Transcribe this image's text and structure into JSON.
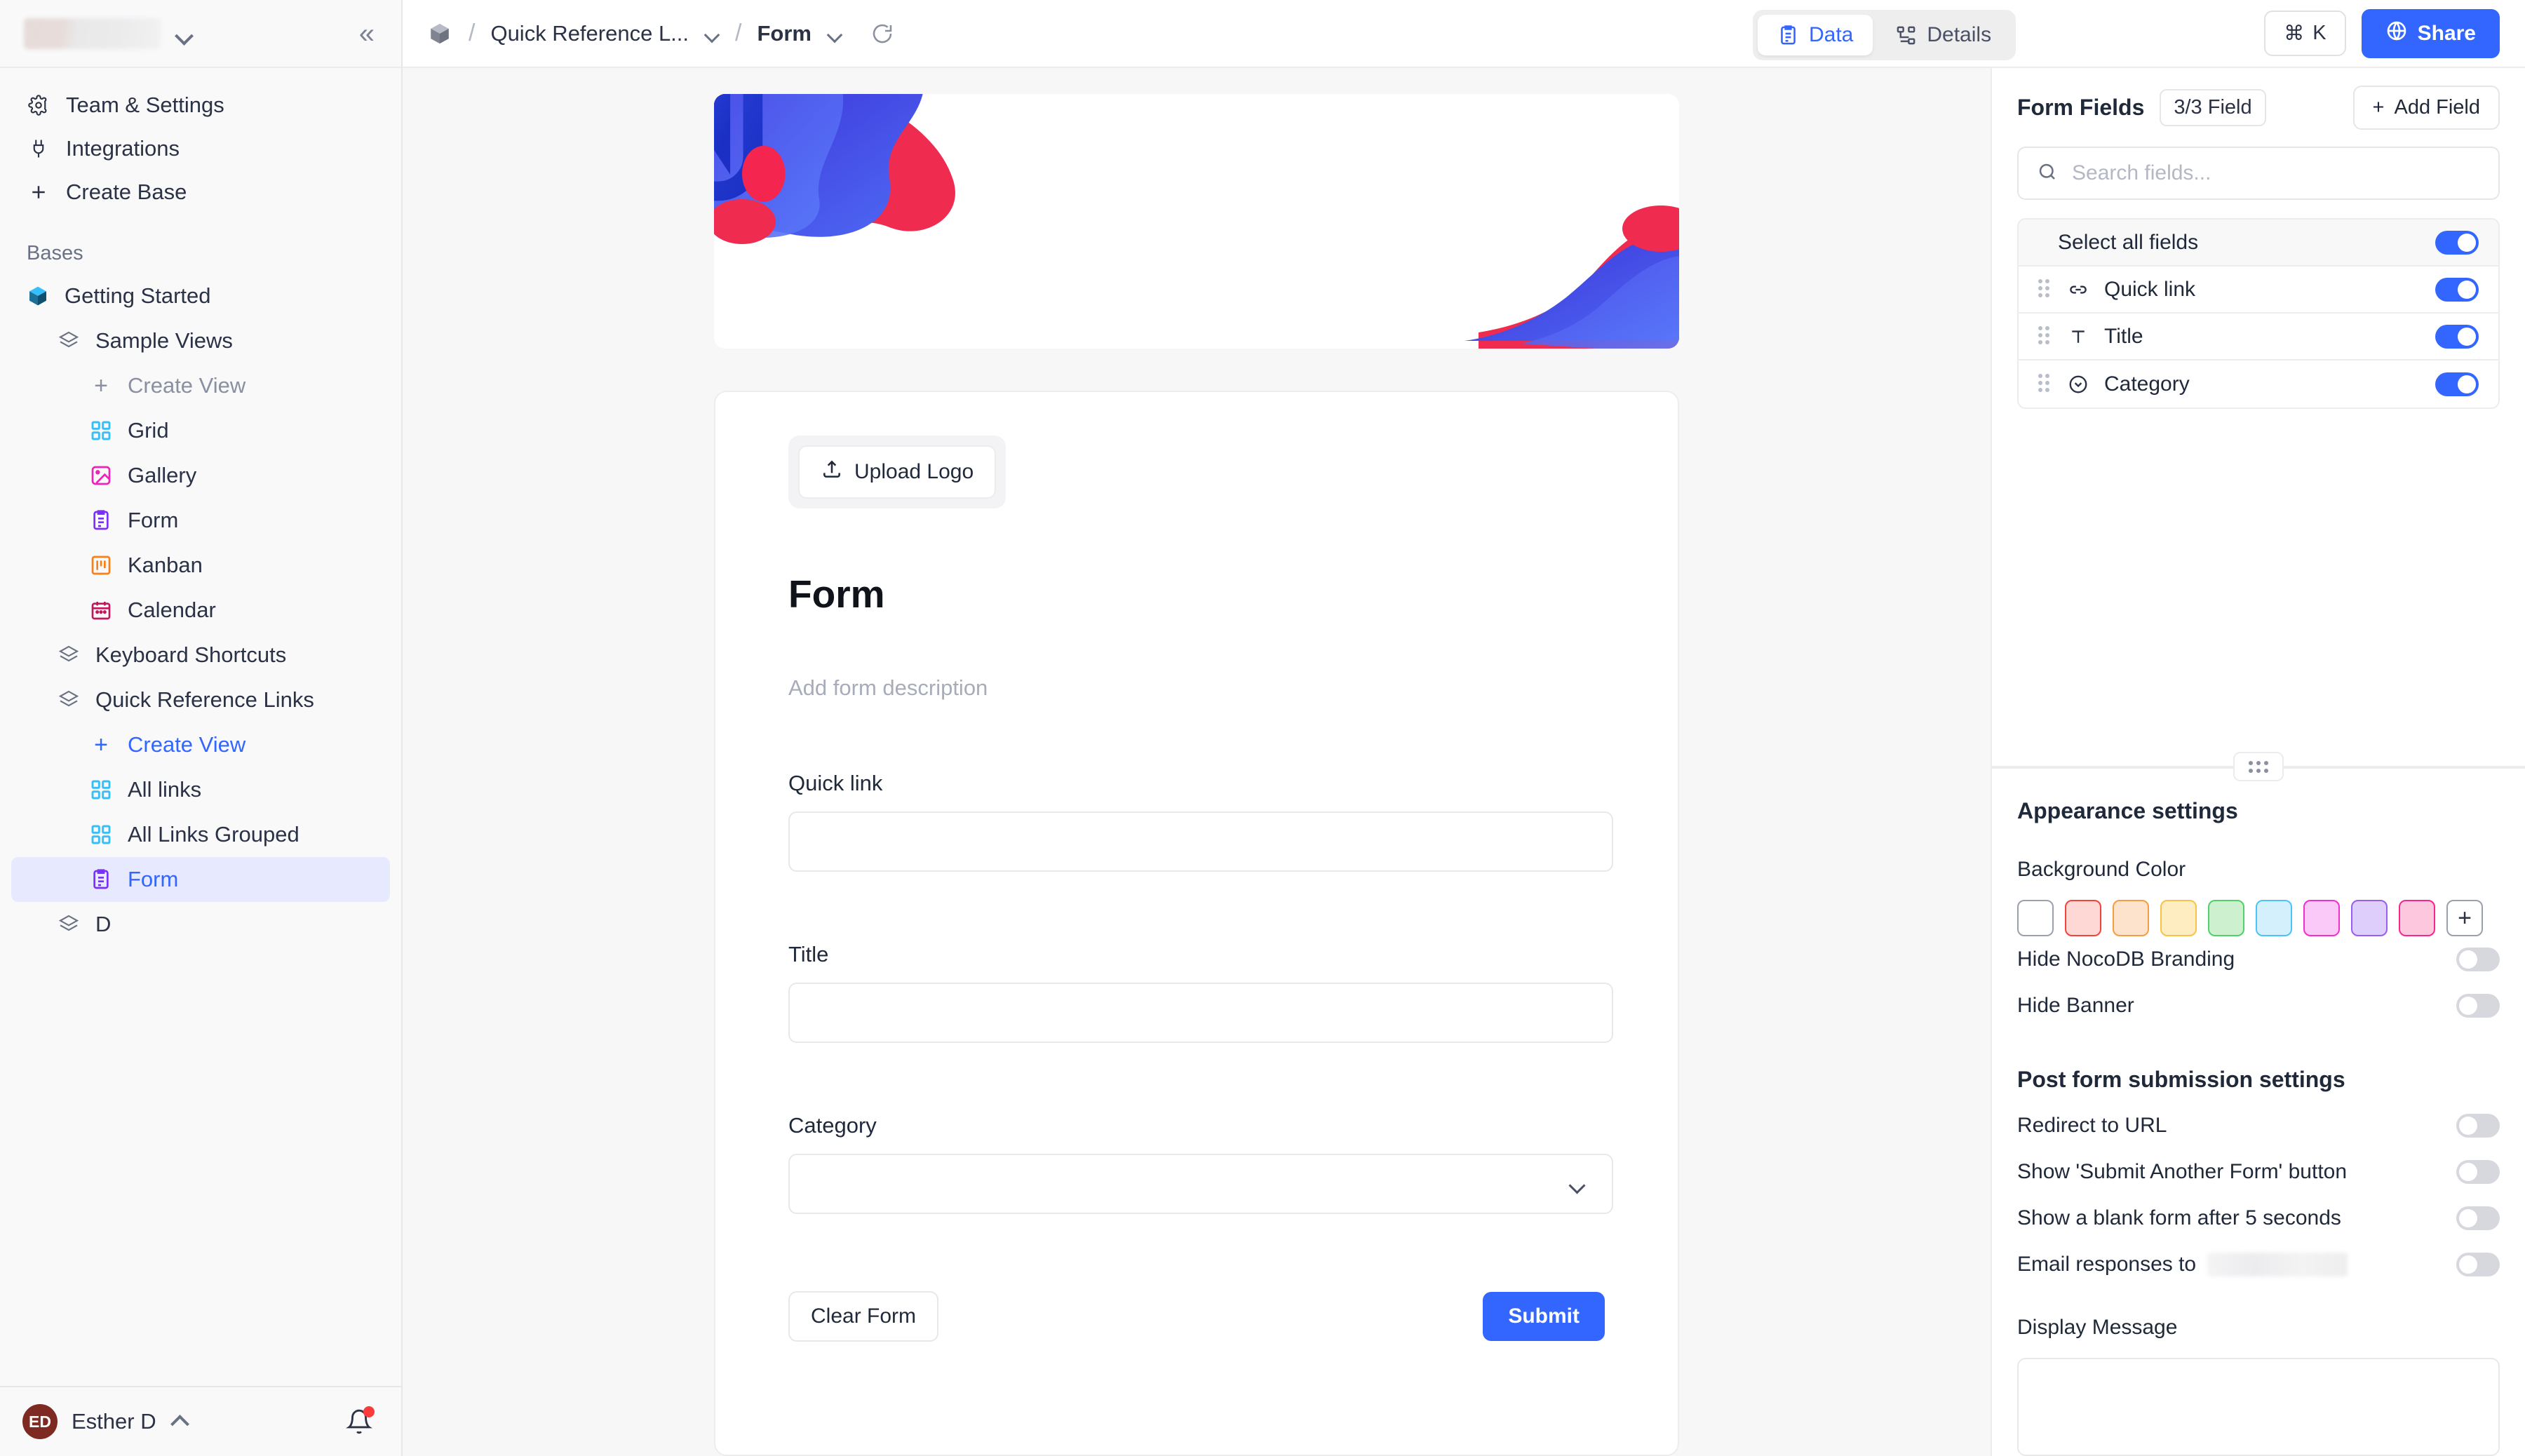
{
  "sidebar": {
    "workspace": {
      "name_redacted": true,
      "chevron_icon": "chevron-down-icon",
      "collapse_icon": "collapse-left-icon"
    },
    "nav": [
      {
        "label": "Team & Settings",
        "icon": "gear-icon"
      },
      {
        "label": "Integrations",
        "icon": "plug-icon"
      },
      {
        "label": "Create Base",
        "icon": "plus-icon"
      }
    ],
    "bases_label": "Bases",
    "tree": [
      {
        "label": "Getting Started",
        "icon": "base-icon",
        "level": 0,
        "state": "normal"
      },
      {
        "label": "Sample Views",
        "icon": "table-icon",
        "level": 1,
        "state": "normal"
      },
      {
        "label": "Create View",
        "icon": "plus-icon",
        "level": 2,
        "state": "muted"
      },
      {
        "label": "Grid",
        "icon": "grid-view-icon",
        "level": 2,
        "state": "normal"
      },
      {
        "label": "Gallery",
        "icon": "gallery-view-icon",
        "level": 2,
        "state": "normal"
      },
      {
        "label": "Form",
        "icon": "form-view-icon",
        "level": 2,
        "state": "normal"
      },
      {
        "label": "Kanban",
        "icon": "kanban-view-icon",
        "level": 2,
        "state": "normal"
      },
      {
        "label": "Calendar",
        "icon": "calendar-view-icon",
        "level": 2,
        "state": "normal"
      },
      {
        "label": "Keyboard Shortcuts",
        "icon": "table-icon",
        "level": 1,
        "state": "normal"
      },
      {
        "label": "Quick Reference Links",
        "icon": "table-icon",
        "level": 1,
        "state": "normal"
      },
      {
        "label": "Create View",
        "icon": "plus-icon",
        "level": 2,
        "state": "accent"
      },
      {
        "label": "All links",
        "icon": "grid-view-icon",
        "level": 2,
        "state": "normal"
      },
      {
        "label": "All Links Grouped",
        "icon": "grid-view-icon",
        "level": 2,
        "state": "normal"
      },
      {
        "label": "Form",
        "icon": "form-view-icon",
        "level": 2,
        "state": "selected"
      },
      {
        "label": "D",
        "icon": "table-icon",
        "level": 1,
        "state": "normal"
      }
    ],
    "user": {
      "initials": "ED",
      "name": "Esther D",
      "chevron_icon": "chevron-up-icon",
      "bell_icon": "bell-icon",
      "has_notification": true
    }
  },
  "topbar": {
    "breadcrumb": {
      "base_icon": "base-hex-icon",
      "table": "Quick Reference L...",
      "view": "Form",
      "separator": "/"
    },
    "reload_icon": "reload-icon",
    "tabs": [
      {
        "label": "Data",
        "icon": "clipboard-icon",
        "active": true
      },
      {
        "label": "Details",
        "icon": "schema-icon",
        "active": false
      }
    ],
    "cmdk_label": "K",
    "cmdk_symbol": "⌘",
    "share_label": "Share",
    "share_icon": "globe-icon"
  },
  "form": {
    "banner": {
      "logo_icon": "nocodb-n-logo"
    },
    "upload_logo_label": "Upload Logo",
    "upload_icon": "upload-icon",
    "title": "Form",
    "description_placeholder": "Add form description",
    "fields": [
      {
        "label": "Quick link",
        "type": "text"
      },
      {
        "label": "Title",
        "type": "text"
      },
      {
        "label": "Category",
        "type": "select"
      }
    ],
    "clear_label": "Clear Form",
    "submit_label": "Submit"
  },
  "right_panel": {
    "title": "Form Fields",
    "count": "3/3 Field",
    "add_field_label": "Add Field",
    "add_field_icon": "plus-icon",
    "search_placeholder": "Search fields...",
    "search_value": "",
    "search_icon": "search-icon",
    "select_all_label": "Select all fields",
    "select_all_on": true,
    "fields": [
      {
        "label": "Quick link",
        "icon": "link-icon",
        "enabled": true
      },
      {
        "label": "Title",
        "icon": "text-field-icon",
        "enabled": true
      },
      {
        "label": "Category",
        "icon": "single-select-icon",
        "enabled": true
      }
    ],
    "appearance": {
      "title": "Appearance settings",
      "bg_color_label": "Background Color",
      "swatches": [
        {
          "name": "white",
          "fill": "#ffffff",
          "border": "#9ba0ad"
        },
        {
          "name": "red",
          "fill": "#fdd8d5",
          "border": "#f4433a"
        },
        {
          "name": "orange",
          "fill": "#fde3cb",
          "border": "#f89c44"
        },
        {
          "name": "yellow",
          "fill": "#fdedc0",
          "border": "#f7c24a"
        },
        {
          "name": "green",
          "fill": "#cdf0cf",
          "border": "#52d06a"
        },
        {
          "name": "blue",
          "fill": "#d4f0fd",
          "border": "#4bc3f7"
        },
        {
          "name": "magenta",
          "fill": "#fbc9f8",
          "border": "#f22ed0"
        },
        {
          "name": "purple",
          "fill": "#ddcefb",
          "border": "#9b5df0"
        },
        {
          "name": "pink",
          "fill": "#fdc8dd",
          "border": "#f7268d"
        }
      ],
      "add_color_label": "+",
      "options": [
        {
          "label": "Hide NocoDB Branding",
          "enabled": false
        },
        {
          "label": "Hide Banner",
          "enabled": false
        }
      ]
    },
    "post_submission": {
      "title": "Post form submission settings",
      "options": [
        {
          "label": "Redirect to URL",
          "enabled": false,
          "redacted_value": false
        },
        {
          "label": "Show 'Submit Another Form' button",
          "enabled": false,
          "redacted_value": false
        },
        {
          "label": "Show a blank form after 5 seconds",
          "enabled": false,
          "redacted_value": false
        },
        {
          "label": "Email responses to",
          "enabled": false,
          "redacted_value": true
        }
      ],
      "display_message_label": "Display Message",
      "display_message_value": ""
    }
  }
}
